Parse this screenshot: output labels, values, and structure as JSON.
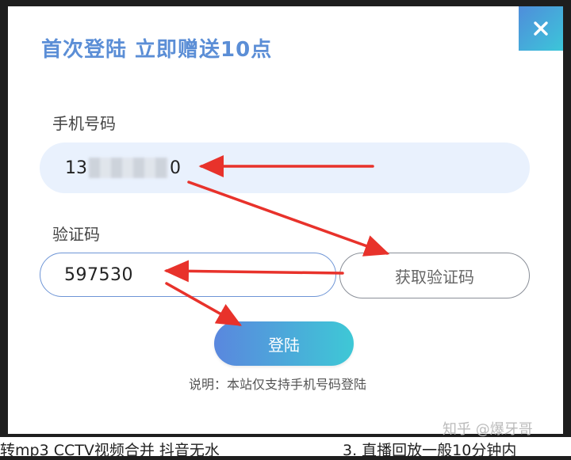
{
  "modal": {
    "title": "首次登陆 立即赠送10点",
    "close_icon": "close-icon",
    "phone": {
      "label": "手机号码",
      "value_prefix": "13",
      "value_suffix": "0"
    },
    "code": {
      "label": "验证码",
      "value": "597530",
      "get_code_label": "获取验证码"
    },
    "login_label": "登陆",
    "note": "说明：本站仅支持手机号码登陆"
  },
  "background": {
    "line1": "转mp3 CCTV视频合并 抖音无水",
    "line2": "3. 直播回放一般10分钟内",
    "watermark": "知乎 @爆牙哥"
  },
  "colors": {
    "accent": "#5b8ed6",
    "gradient_start": "#5a87de",
    "gradient_end": "#3ec8d6",
    "arrow": "#e8322b"
  }
}
